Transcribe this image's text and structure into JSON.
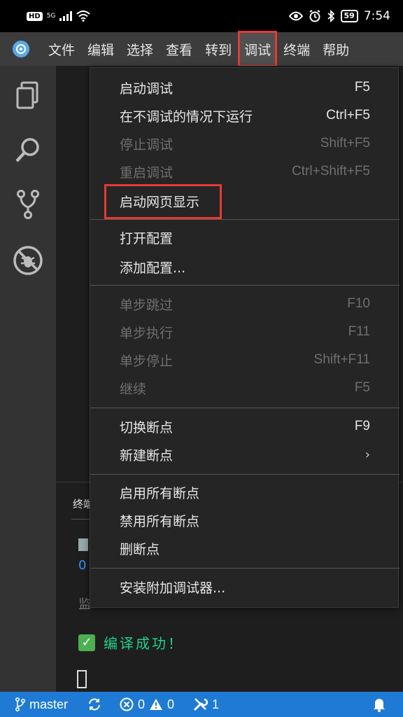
{
  "status_bar": {
    "hd": "HD",
    "network": "5G",
    "battery": "59",
    "time": "7:54"
  },
  "menubar": {
    "items": [
      {
        "label": "文件"
      },
      {
        "label": "编辑"
      },
      {
        "label": "选择"
      },
      {
        "label": "查看"
      },
      {
        "label": "转到"
      },
      {
        "label": "调试"
      },
      {
        "label": "终端"
      },
      {
        "label": "帮助"
      }
    ]
  },
  "menu": {
    "items": [
      {
        "label": "启动调试",
        "shortcut": "F5",
        "disabled": false
      },
      {
        "label": "在不调试的情况下运行",
        "shortcut": "Ctrl+F5",
        "disabled": false
      },
      {
        "label": "停止调试",
        "shortcut": "Shift+F5",
        "disabled": true
      },
      {
        "label": "重启调试",
        "shortcut": "Ctrl+Shift+F5",
        "disabled": true
      },
      {
        "label": "启动网页显示",
        "shortcut": "",
        "disabled": false
      },
      {
        "label": "打开配置",
        "shortcut": "",
        "disabled": false
      },
      {
        "label": "添加配置...",
        "shortcut": "",
        "disabled": false
      },
      {
        "label": "单步跳过",
        "shortcut": "F10",
        "disabled": true
      },
      {
        "label": "单步执行",
        "shortcut": "F11",
        "disabled": true
      },
      {
        "label": "单步停止",
        "shortcut": "Shift+F11",
        "disabled": true
      },
      {
        "label": "继续",
        "shortcut": "F5",
        "disabled": true
      },
      {
        "label": "切换断点",
        "shortcut": "F9",
        "disabled": false
      },
      {
        "label": "新建断点",
        "shortcut": "",
        "disabled": false
      },
      {
        "label": "启用所有断点",
        "shortcut": "",
        "disabled": false
      },
      {
        "label": "禁用所有断点",
        "shortcut": "",
        "disabled": false
      },
      {
        "label": "删断点",
        "shortcut": "",
        "disabled": false
      },
      {
        "label": "安装附加调试器...",
        "shortcut": "",
        "disabled": false
      }
    ]
  },
  "terminal": {
    "tab_label": "终端",
    "line2": "0",
    "line3": "监",
    "success_text": "编译成功！"
  },
  "bottom_bar": {
    "branch": "master",
    "errors": "0",
    "warnings": "0",
    "tools_count": "1"
  },
  "colors": {
    "menubar_bg": "#3c3c3c",
    "activity_bg": "#333333",
    "menu_bg": "#252526",
    "statusbar_blue": "#1e7ad4",
    "highlight_red": "#e53935",
    "success_green": "#23d18b"
  }
}
